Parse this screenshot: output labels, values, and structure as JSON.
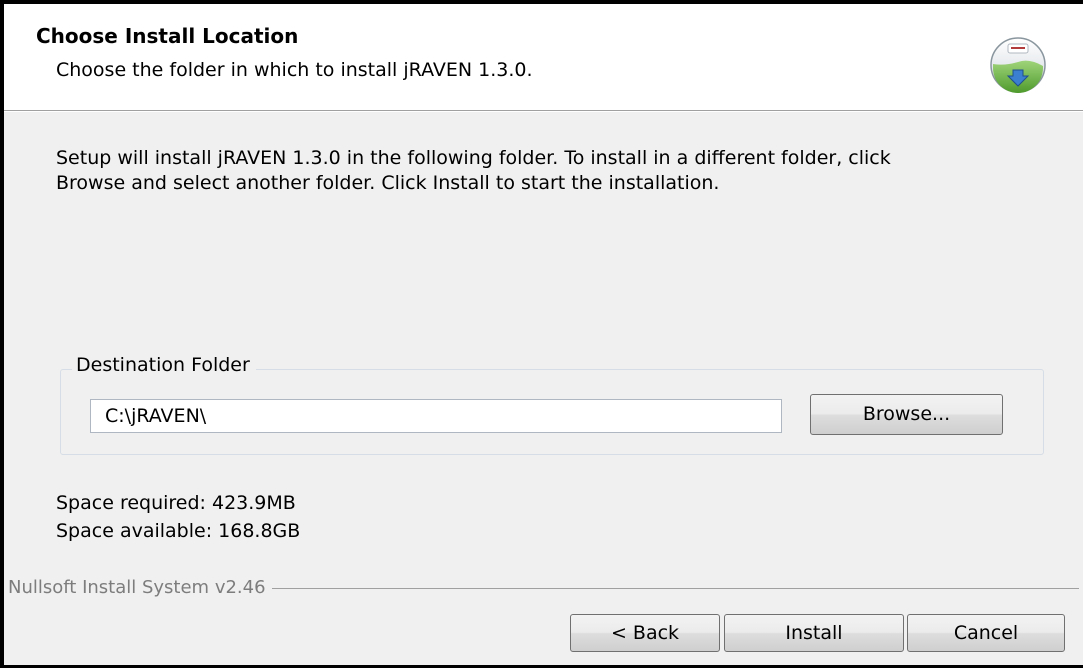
{
  "header": {
    "title": "Choose Install Location",
    "subtitle": "Choose the folder in which to install jRAVEN 1.3.0.",
    "icon": "installer-globe-icon"
  },
  "body": {
    "intro": "Setup will install jRAVEN 1.3.0 in the following folder. To install in a different folder, click\nBrowse and select another folder. Click Install to start the installation.",
    "destination": {
      "legend": "Destination Folder",
      "path_value": "C:\\jRAVEN\\",
      "browse_label": "Browse..."
    },
    "space_required": "Space required: 423.9MB",
    "space_available": "Space available: 168.8GB"
  },
  "footer": {
    "brand": "Nullsoft Install System v2.46",
    "back_label": "< Back",
    "install_label": "Install",
    "cancel_label": "Cancel"
  },
  "colors": {
    "dialog_bg": "#f0f0f0",
    "header_bg": "#ffffff",
    "brand_text": "#7d7d7d",
    "icon_green": "#6fb84a",
    "icon_blue": "#3a7fd0"
  }
}
